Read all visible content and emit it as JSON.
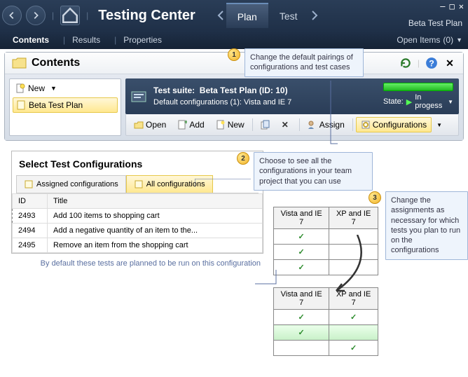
{
  "app": {
    "title": "Testing Center",
    "plan_name": "Beta Test Plan"
  },
  "main_tabs": {
    "plan": "Plan",
    "test": "Test"
  },
  "sub_tabs": {
    "contents": "Contents",
    "results": "Results",
    "properties": "Properties"
  },
  "open_items": {
    "label": "Open Items",
    "count": "(0)"
  },
  "contents": {
    "header": "Contents",
    "new_btn": "New",
    "tree_item": "Beta Test Plan"
  },
  "suite": {
    "title_prefix": "Test suite:",
    "title_name": "Beta Test Plan (ID: 10)",
    "subtitle": "Default configurations (1): Vista and IE 7",
    "state_label": "State:",
    "state_value": "In progess"
  },
  "toolbar": {
    "open": "Open",
    "add": "Add",
    "new": "New",
    "assign": "Assign",
    "configurations": "Configurations"
  },
  "callouts": {
    "c1": "Change the default pairings of configurations and test cases",
    "c2": "Choose to see all the configurations in your team project that you can use",
    "c3": "Change the assignments as necessary for which tests you plan to run on the configurations"
  },
  "config_panel": {
    "title": "Select Test Configurations",
    "tab_assigned": "Assigned configurations",
    "tab_all": "All configurations",
    "col_id": "ID",
    "col_title": "Title",
    "rows": [
      {
        "id": "2493",
        "title": "Add 100 items to shopping cart"
      },
      {
        "id": "2494",
        "title": "Add a negative quantity of an item to the..."
      },
      {
        "id": "2495",
        "title": "Remove an item from the shopping cart"
      }
    ],
    "footnote": "By default these tests are planned to be run on this configuration"
  },
  "grids": {
    "col_vista": "Vista and IE 7",
    "col_xp": "XP and IE 7"
  }
}
